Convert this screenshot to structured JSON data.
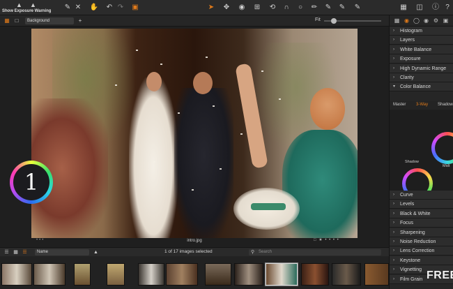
{
  "toolbar": {
    "exposure_warning_label": "Show Exposure Warning"
  },
  "subbar": {
    "layer_name": "Background",
    "fit_label": "Fit"
  },
  "viewer": {
    "filename": "intro.jpg"
  },
  "browser": {
    "sort_by": "Name",
    "count_text": "1 of 17 images selected",
    "search_placeholder": "Search"
  },
  "panel": {
    "tools_top": [
      "Histogram",
      "Layers",
      "White Balance",
      "Exposure",
      "High Dynamic Range",
      "Clarity",
      "Color Balance"
    ],
    "color_balance_tabs": [
      "Master",
      "3-Way",
      "Shadow"
    ],
    "wheel_labels": [
      "Shadow",
      "Midt"
    ],
    "tools_bottom": [
      "Curve",
      "Levels",
      "Black & White",
      "Focus",
      "Sharpening",
      "Noise Reduction",
      "Lens Correction",
      "Keystone",
      "Vignetting",
      "Film Grain"
    ]
  },
  "watermark": "FREE",
  "colors": {
    "accent": "#e07a1a",
    "background": "#1e1e1e",
    "panel": "#262626"
  }
}
